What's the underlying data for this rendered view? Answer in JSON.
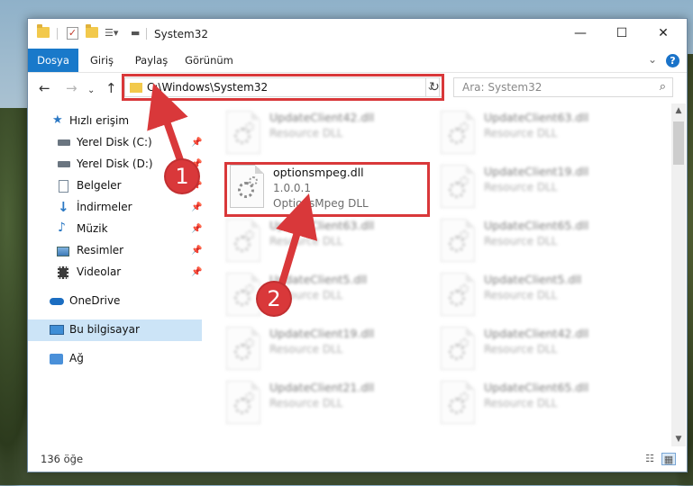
{
  "window": {
    "title": "System32",
    "controls": {
      "minimize": "—",
      "maximize": "☐",
      "close": "✕"
    }
  },
  "ribbon": {
    "tabs": [
      "Dosya",
      "Giriş",
      "Paylaş",
      "Görünüm"
    ],
    "help": "?"
  },
  "navigation": {
    "address": "C:\\Windows\\System32",
    "search_placeholder": "Ara: System32"
  },
  "sidebar": {
    "items": [
      {
        "label": "Hızlı erişim",
        "icon": "star-icon"
      },
      {
        "label": "Yerel Disk (C:)",
        "icon": "drive-icon",
        "pinned": true
      },
      {
        "label": "Yerel Disk (D:)",
        "icon": "drive-icon",
        "pinned": true
      },
      {
        "label": "Belgeler",
        "icon": "documents-icon",
        "pinned": true
      },
      {
        "label": "İndirmeler",
        "icon": "download-icon",
        "pinned": true
      },
      {
        "label": "Müzik",
        "icon": "music-icon",
        "pinned": true
      },
      {
        "label": "Resimler",
        "icon": "pictures-icon",
        "pinned": true
      },
      {
        "label": "Videolar",
        "icon": "videos-icon",
        "pinned": true
      },
      {
        "label": "OneDrive",
        "icon": "cloud-icon"
      },
      {
        "label": "Bu bilgisayar",
        "icon": "computer-icon",
        "selected": true
      },
      {
        "label": "Ağ",
        "icon": "network-icon"
      }
    ]
  },
  "files": {
    "col1": [
      {
        "name": "UpdateClient42.dll",
        "line2": "Resource DLL"
      },
      {
        "name": "optionsmpeg.dll",
        "line2": "1.0.0.1",
        "line3": "OptionsMpeg DLL",
        "highlighted": true
      },
      {
        "name": "UpdateClient63.dll",
        "line2": "Resource DLL"
      },
      {
        "name": "UpdateClient5.dll",
        "line2": "Resource DLL"
      },
      {
        "name": "UpdateClient19.dll",
        "line2": "Resource DLL"
      },
      {
        "name": "UpdateClient21.dll",
        "line2": "Resource DLL"
      }
    ],
    "col2": [
      {
        "name": "UpdateClient63.dll",
        "line2": "Resource DLL"
      },
      {
        "name": "UpdateClient19.dll",
        "line2": "Resource DLL"
      },
      {
        "name": "UpdateClient65.dll",
        "line2": "Resource DLL"
      },
      {
        "name": "UpdateClient5.dll",
        "line2": "Resource DLL"
      },
      {
        "name": "UpdateClient42.dll",
        "line2": "Resource DLL"
      },
      {
        "name": "UpdateClient65.dll",
        "line2": "Resource DLL"
      }
    ]
  },
  "status": {
    "count": "136 öğe"
  },
  "callouts": [
    "1",
    "2"
  ],
  "colors": {
    "accent": "#1979ca",
    "highlight": "#d9383a",
    "selected": "#cce4f7"
  }
}
